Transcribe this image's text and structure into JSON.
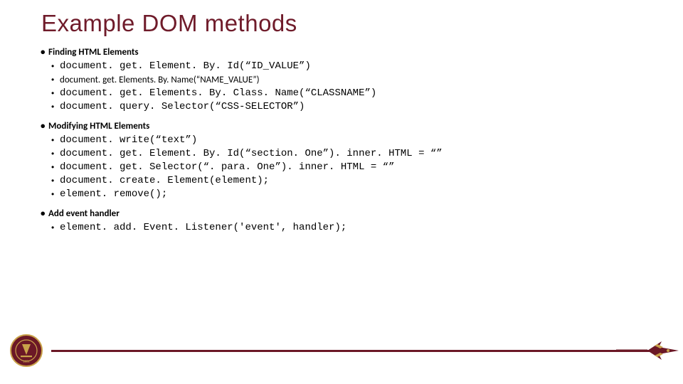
{
  "title": "Example DOM methods",
  "sections": [
    {
      "heading": "Finding HTML Elements",
      "items": [
        {
          "text": "document. get. Element. By. Id(“ID_VALUE”)",
          "sans": false,
          "small": false
        },
        {
          "text": "document. get. Elements. By. Name(“NAME_VALUE”)",
          "sans": true,
          "small": true
        },
        {
          "text": "document. get. Elements. By. Class. Name(“CLASSNAME”)",
          "sans": false,
          "small": false
        },
        {
          "text": "document. query. Selector(“CSS-SELECTOR”)",
          "sans": false,
          "small": false
        }
      ]
    },
    {
      "heading": "Modifying HTML Elements",
      "items": [
        {
          "text": "document. write(“text”)",
          "sans": false,
          "small": false
        },
        {
          "text": "document. get. Element. By. Id(“section. One”). inner. HTML = “”",
          "sans": false,
          "small": false
        },
        {
          "text": "document. get. Selector(“. para. One”). inner. HTML = “”",
          "sans": false,
          "small": false
        },
        {
          "text": "document. create. Element(element);",
          "sans": false,
          "small": false
        },
        {
          "text": "element. remove();",
          "sans": false,
          "small": false
        }
      ]
    },
    {
      "heading": "Add event handler",
      "items": [
        {
          "text": "element. add. Event. Listener('event', handler);",
          "sans": false,
          "small": false
        }
      ]
    }
  ],
  "colors": {
    "accent": "#6b1826",
    "title": "#6f1b2a",
    "gold": "#c9a24a"
  }
}
